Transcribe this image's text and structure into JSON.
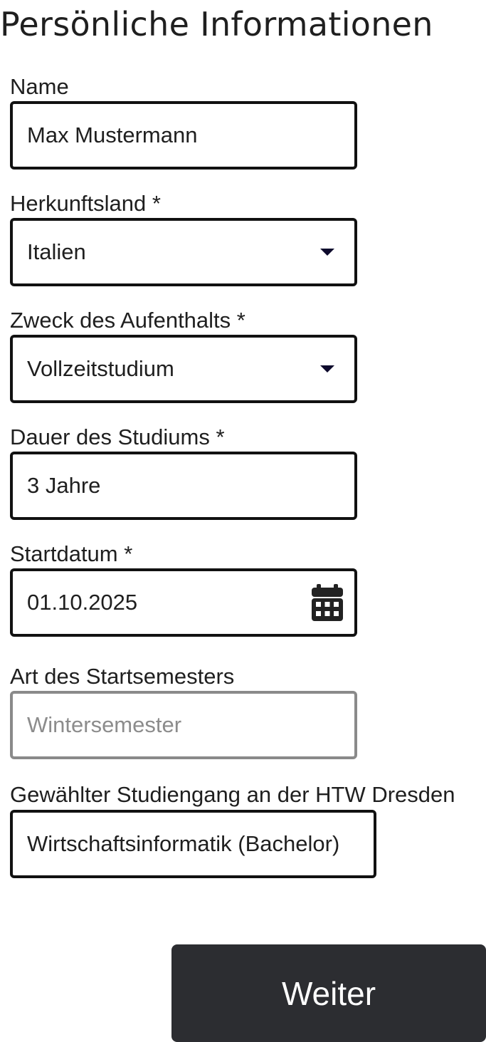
{
  "page": {
    "title": "Persönliche Informationen"
  },
  "form": {
    "name": {
      "label": "Name",
      "value": "Max Mustermann"
    },
    "country": {
      "label": "Herkunftsland *",
      "selected": "Italien",
      "icon": "chevron-down-icon"
    },
    "purpose": {
      "label": "Zweck des Aufenthalts *",
      "selected": "Vollzeitstudium",
      "icon": "chevron-down-icon"
    },
    "duration": {
      "label": "Dauer des Studiums *",
      "value": "3 Jahre"
    },
    "start_date": {
      "label": "Startdatum *",
      "value": "01.10.2025",
      "icon": "calendar-icon"
    },
    "semester_type": {
      "label": "Art des Startsemesters",
      "placeholder": "Wintersemester",
      "disabled": true
    },
    "program": {
      "label": "Gewählter Studiengang an der HTW Dresden",
      "value": "Wirtschaftsinformatik (Bachelor)"
    }
  },
  "actions": {
    "next_label": "Weiter"
  },
  "colors": {
    "text": "#1f1f1f",
    "border": "#111111",
    "disabled_border": "#8a8a8a",
    "placeholder": "#8c8c8c",
    "button_bg": "#2c2d31",
    "button_text": "#ffffff",
    "caret": "#0d0a2c"
  }
}
